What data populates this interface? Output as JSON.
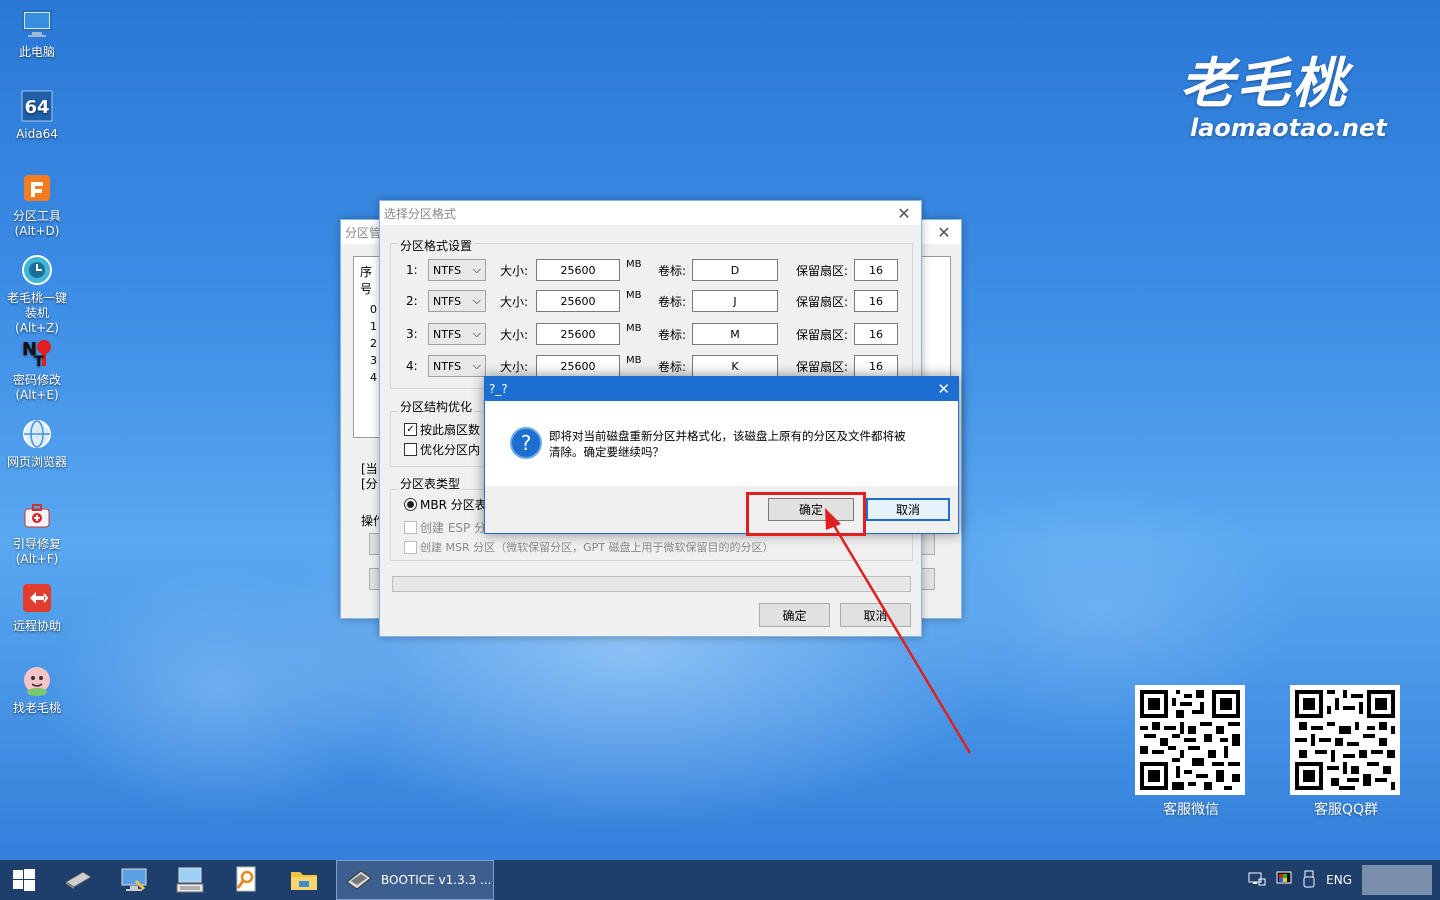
{
  "desktop": {
    "icons": [
      {
        "label": "此电脑",
        "icon": "computer-icon"
      },
      {
        "label": "Aida64",
        "icon": "aida64-icon"
      },
      {
        "label": "分区工具\n(Alt+D)",
        "icon": "partition-tool-icon"
      },
      {
        "label": "老毛桃一键\n装机(Alt+Z)",
        "icon": "installer-icon"
      },
      {
        "label": "密码修改\n(Alt+E)",
        "icon": "password-icon"
      },
      {
        "label": "网页浏览器",
        "icon": "browser-icon"
      },
      {
        "label": "引导修复\n(Alt+F)",
        "icon": "boot-repair-icon"
      },
      {
        "label": "远程协助",
        "icon": "remote-assist-icon"
      },
      {
        "label": "找老毛桃",
        "icon": "find-laomaotao-icon"
      }
    ],
    "brand_cn": "老毛桃",
    "brand_url": "laomaotao.net",
    "qr_codes": [
      {
        "label": "客服微信"
      },
      {
        "label": "客服QQ群"
      }
    ]
  },
  "bg_window": {
    "title": "分区管",
    "list_header": "序号",
    "list_rows": [
      "0",
      "1",
      "2",
      "3",
      "4"
    ],
    "status_1": "[当",
    "status_2": "[分",
    "ops_label": "操作"
  },
  "format_dialog": {
    "title": "选择分区格式",
    "settings_group": "分区格式设置",
    "size_label": "大小:",
    "unit": "MB",
    "volume_label": "卷标:",
    "reserved_label": "保留扇区:",
    "partitions": [
      {
        "index": "1:",
        "fs": "NTFS",
        "size": "25600",
        "volume": "D",
        "reserved": "16"
      },
      {
        "index": "2:",
        "fs": "NTFS",
        "size": "25600",
        "volume": "J",
        "reserved": "16"
      },
      {
        "index": "3:",
        "fs": "NTFS",
        "size": "25600",
        "volume": "M",
        "reserved": "16"
      },
      {
        "index": "4:",
        "fs": "NTFS",
        "size": "25600",
        "volume": "K",
        "reserved": "16"
      }
    ],
    "struct_group": "分区结构优化",
    "align_checkbox": "按此扇区数",
    "optimize_checkbox": "优化分区内",
    "table_group": "分区表类型",
    "mbr_radio": "MBR 分区表",
    "esp_checkbox": "创建 ESP 分区",
    "msr_checkbox": "创建 MSR 分区（微软保留分区，GPT 磁盘上用于微软保留目的的分区）",
    "ok": "确定",
    "cancel": "取消"
  },
  "confirm_dialog": {
    "title": "?_?",
    "message_line1": "即将对当前磁盘重新分区并格式化，该磁盘上原有的分区及文件都将被",
    "message_line2": "清除。确定要继续吗？",
    "ok": "确定",
    "cancel": "取消"
  },
  "taskbar": {
    "active_app": "BOOTICE v1.3.3 ...",
    "lang": "ENG"
  },
  "colors": {
    "annotation_red": "#e02020",
    "dialog_accent": "#1c6fd0"
  }
}
